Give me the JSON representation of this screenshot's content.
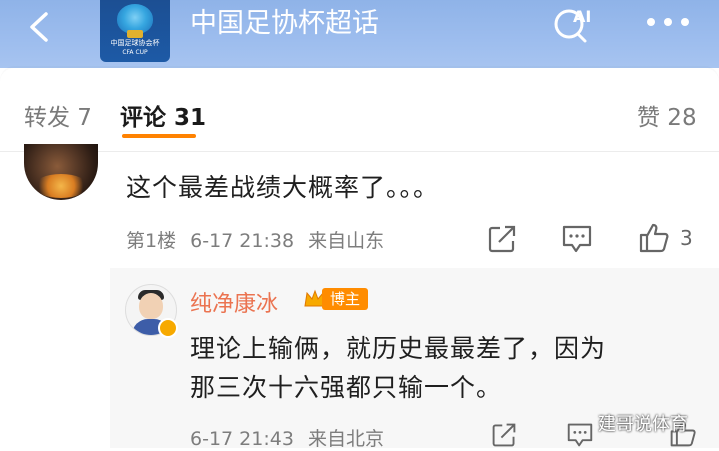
{
  "header": {
    "title": "中国足协杯超话",
    "logo_text": "中国足球协会杯",
    "logo_sub": "CFA CUP",
    "back_icon": "chevron-left-icon",
    "ai_search_icon": "ai-search-icon",
    "ai_label": "AI",
    "more_icon": "more-dots-icon",
    "bg_color": "#9dbdee"
  },
  "tabs": {
    "reposts_label": "转发 7",
    "comments_label": "评论 31",
    "likes_label": "赞 28",
    "accent_color": "#ff8200"
  },
  "comment": {
    "text": "这个最差战绩大概率了。。。",
    "floor": "第1楼",
    "time": "6-17 21:38",
    "location": "来自山东",
    "like_count": "3",
    "icons": [
      "share-icon",
      "reply-icon",
      "like-icon"
    ]
  },
  "reply": {
    "username": "纯净康冰",
    "badge": "博主",
    "username_color": "#eb7350",
    "line1": "理论上输俩，就历史最最差了，因为",
    "line2": "那三次十六强都只输一个。",
    "time": "6-17 21:43",
    "location": "来自北京"
  },
  "watermark": "建哥说体育"
}
